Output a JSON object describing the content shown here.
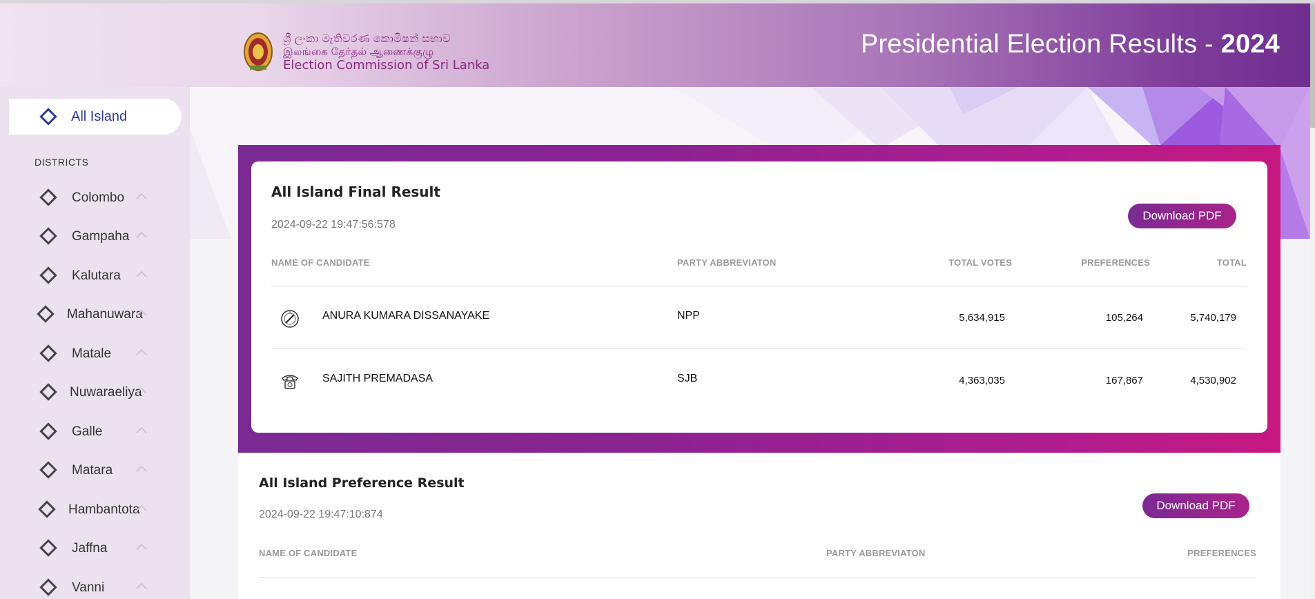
{
  "header": {
    "logo_sinhala": "ශ්‍රී ලංකා මැතිවරණ කොමිෂන් සභාව",
    "logo_tamil": "இலங்கை தேர்தல் ஆணைக்குழு",
    "logo_english": "Election Commission of Sri Lanka",
    "title_prefix": "Presidential Election Results - ",
    "title_year": "2024"
  },
  "sidebar": {
    "all_island_label": "All Island",
    "districts_heading": "DISTRICTS",
    "districts": [
      "Colombo",
      "Gampaha",
      "Kalutara",
      "Mahanuwara",
      "Matale",
      "Nuwaraeliya",
      "Galle",
      "Matara",
      "Hambantota",
      "Jaffna",
      "Vanni"
    ]
  },
  "final_result": {
    "title": "All Island Final Result",
    "timestamp": "2024-09-22 19:47:56:578",
    "download_label": "Download PDF",
    "columns": [
      "NAME OF CANDIDATE",
      "PARTY ABBREVIATON",
      "TOTAL VOTES",
      "PREFERENCES",
      "TOTAL"
    ],
    "rows": [
      {
        "symbol": "compass-symbol",
        "name": "ANURA KUMARA DISSANAYAKE",
        "party": "NPP",
        "total_votes": "5,634,915",
        "preferences": "105,264",
        "total": "5,740,179"
      },
      {
        "symbol": "telephone-symbol",
        "name": "SAJITH PREMADASA",
        "party": "SJB",
        "total_votes": "4,363,035",
        "preferences": "167,867",
        "total": "4,530,902"
      }
    ]
  },
  "preference_result": {
    "title": "All Island Preference Result",
    "timestamp": "2024-09-22 19:47:10:874",
    "download_label": "Download PDF",
    "columns": [
      "NAME OF CANDIDATE",
      "PARTY ABBREVIATON",
      "PREFERENCES"
    ]
  },
  "colors": {
    "accent_purple": "#7a2a93",
    "accent_magenta": "#c6187f",
    "nav_active": "#2c3b9a"
  }
}
